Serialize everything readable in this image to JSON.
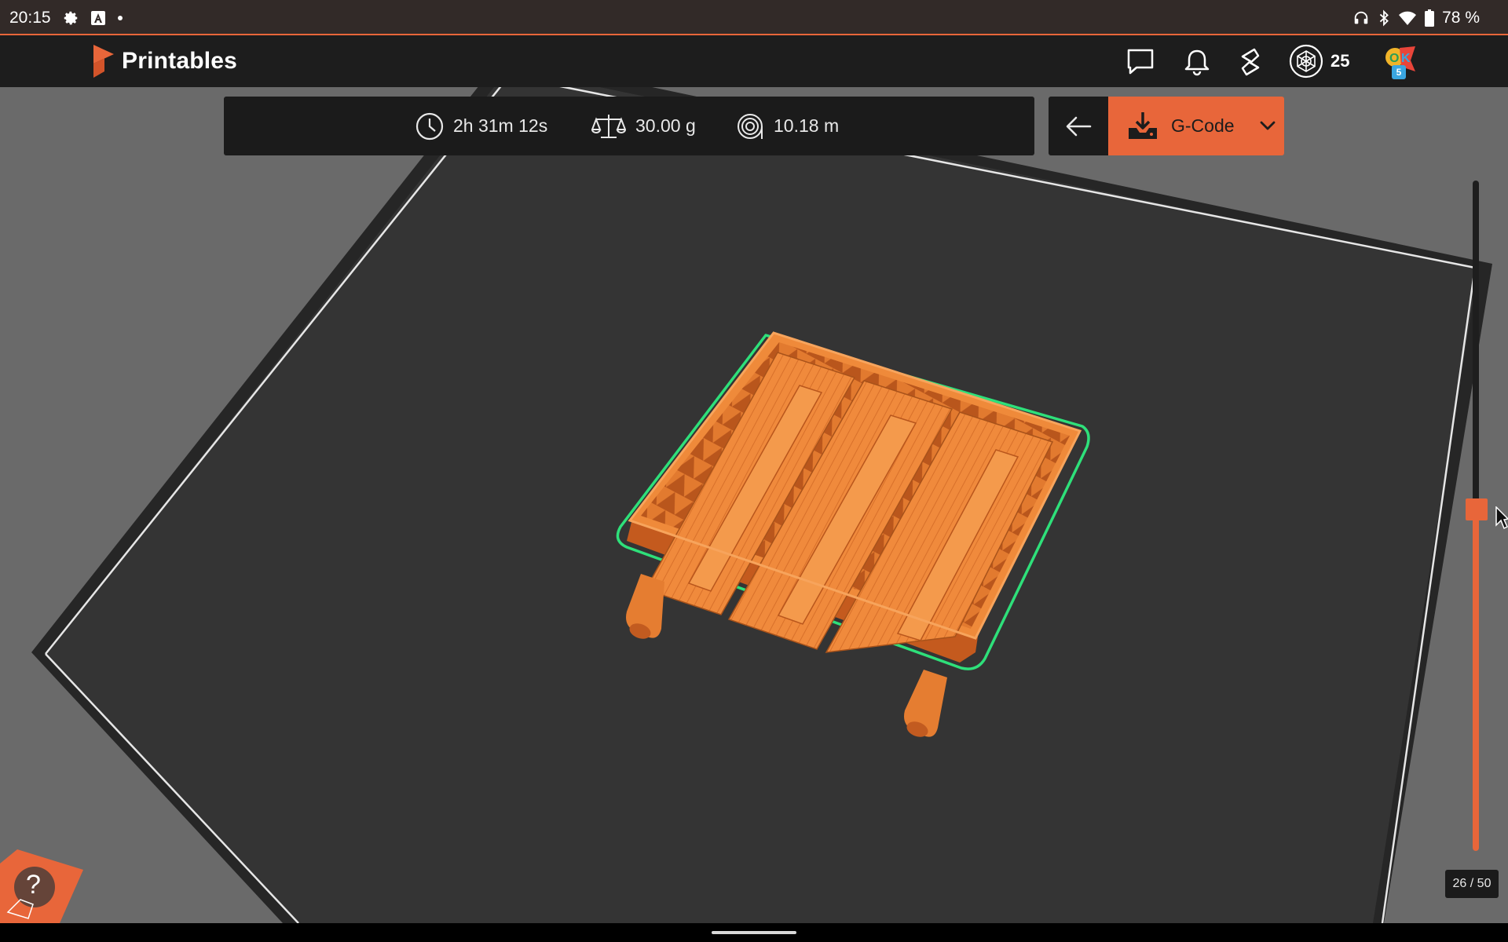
{
  "status_bar": {
    "time": "20:15",
    "battery": "78 %",
    "left_icons": [
      "settings-gear-icon",
      "a-box-icon",
      "dot-icon"
    ],
    "right_icons": [
      "headphones-icon",
      "bluetooth-icon",
      "wifi-icon",
      "battery-icon"
    ]
  },
  "header": {
    "app_name": "Printables",
    "points": "25",
    "avatar_badge": "5",
    "icons": [
      "chat-icon",
      "bell-icon",
      "slicer-icon",
      "points-icon",
      "avatar-icon"
    ]
  },
  "stats": {
    "print_time": "2h 31m 12s",
    "weight": "30.00 g",
    "filament_length": "10.18 m"
  },
  "actions": {
    "download_label": "G-Code"
  },
  "layer_slider": {
    "readout": "26 / 50",
    "current_layer": 26,
    "total_layers": 50
  },
  "help": {
    "label": "?"
  },
  "colors": {
    "accent": "#e8663a",
    "model": "#f0883a",
    "bed": "#333333",
    "background": "#6a6a6a",
    "outline": "#2ecc71"
  }
}
